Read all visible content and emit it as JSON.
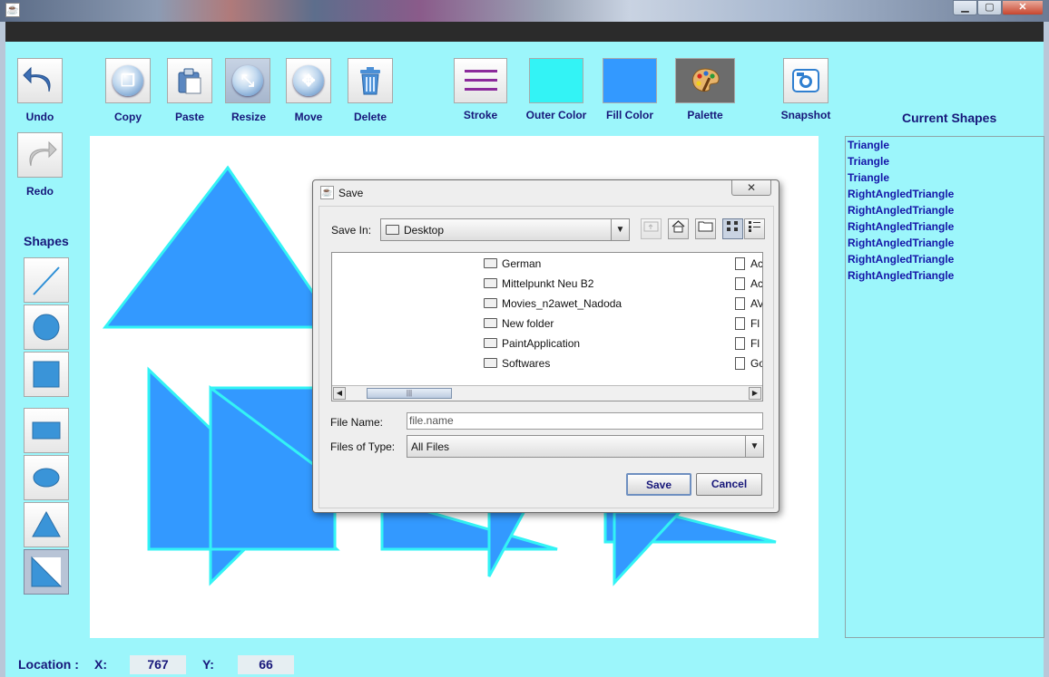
{
  "window": {
    "title": ""
  },
  "toolbar": {
    "undo": "Undo",
    "redo": "Redo",
    "copy": "Copy",
    "paste": "Paste",
    "resize": "Resize",
    "move": "Move",
    "delete": "Delete",
    "stroke": "Stroke",
    "outer_color": "Outer Color",
    "fill_color": "Fill Color",
    "palette": "Palette",
    "snapshot": "Snapshot",
    "outer_color_value": "#33f3f5",
    "fill_color_value": "#3399ff"
  },
  "shapes_panel": {
    "title": "Shapes",
    "items": [
      "line-tool",
      "circle-tool",
      "square-tool",
      "rectangle-tool",
      "ellipse-tool",
      "triangle-tool",
      "right-angled-triangle-tool"
    ],
    "selected": "right-angled-triangle-tool"
  },
  "current_shapes": {
    "title": "Current Shapes",
    "items": [
      "Triangle",
      "Triangle",
      "Triangle",
      "RightAngledTriangle",
      "RightAngledTriangle",
      "RightAngledTriangle",
      "RightAngledTriangle",
      "RightAngledTriangle",
      "RightAngledTriangle"
    ]
  },
  "status": {
    "location_label": "Location :",
    "x_label": "X:",
    "x_value": "767",
    "y_label": "Y:",
    "y_value": "66"
  },
  "save_dialog": {
    "title": "Save",
    "save_in_label": "Save In:",
    "save_in_value": "Desktop",
    "folders": [
      "German",
      "Mittelpunkt Neu B2",
      "Movies_n2awet_Nadoda",
      "New folder",
      "PaintApplication",
      "Softwares"
    ],
    "files_partial": [
      "Ac",
      "Ac",
      "AV",
      "Fl",
      "Fl",
      "Go"
    ],
    "file_name_label": "File Name:",
    "file_name_value": "file.name",
    "files_of_type_label": "Files of Type:",
    "files_of_type_value": "All Files",
    "save_button": "Save",
    "cancel_button": "Cancel"
  },
  "colors": {
    "background": "#9cf6fb",
    "shape_fill": "#3399ff",
    "shape_stroke": "#33f3f5",
    "label": "#17177a",
    "list_text": "#1515a8"
  }
}
